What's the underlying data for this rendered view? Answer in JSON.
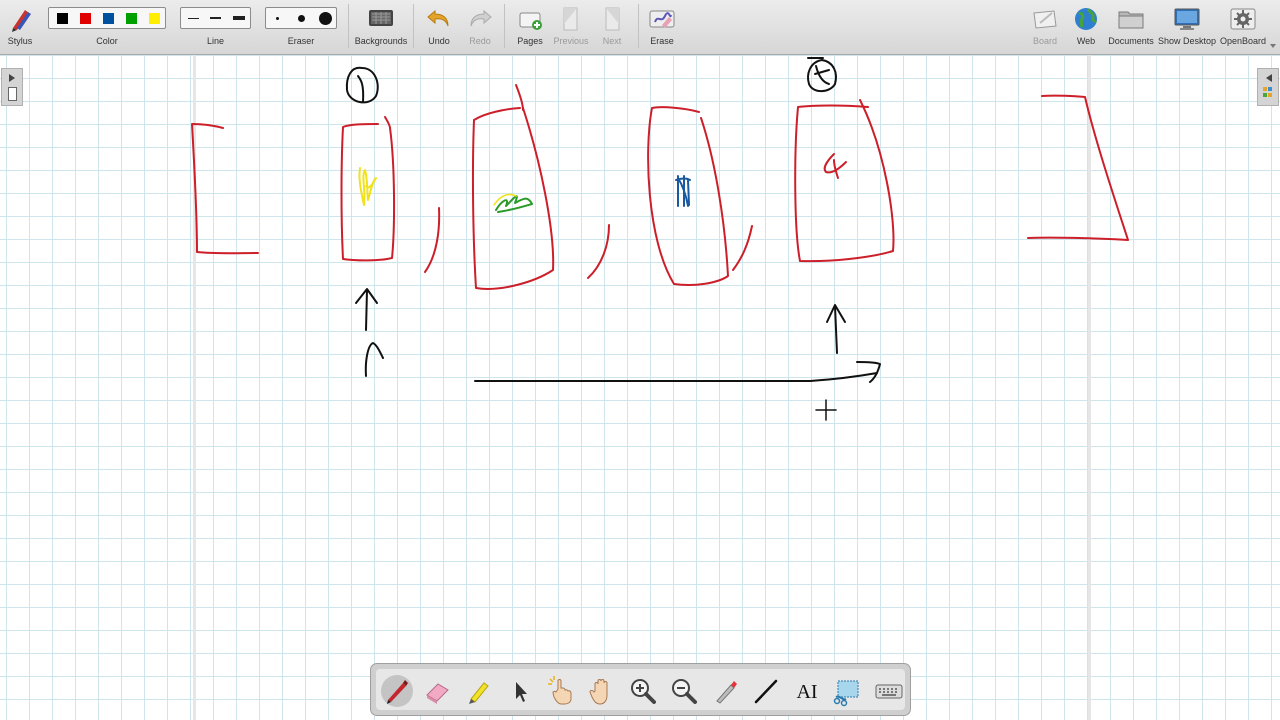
{
  "toolbar": {
    "stylus": "Stylus",
    "color": "Color",
    "line": "Line",
    "eraser": "Eraser",
    "backgrounds": "Backgrounds",
    "undo": "Undo",
    "redo": "Redo",
    "pages": "Pages",
    "previous": "Previous",
    "next": "Next",
    "erase": "Erase",
    "board": "Board",
    "web": "Web",
    "documents": "Documents",
    "show_desktop": "Show Desktop",
    "openboard": "OpenBoard"
  },
  "colors": {
    "palette": [
      "#000000",
      "#e00000",
      "#0050a0",
      "#00a000",
      "#ffee00"
    ],
    "ink_red": "#cc1f2a",
    "ink_black": "#111111",
    "ink_yellow": "#f2e21c",
    "ink_green": "#2a9a2a",
    "ink_blue": "#1a5aa0",
    "grid": "#cfe5ec"
  },
  "bottom_toolbar": {
    "tools": [
      "pen",
      "eraser",
      "highlighter",
      "selector",
      "interactor",
      "hand",
      "zoom-in",
      "zoom-out",
      "laser-pointer",
      "line",
      "text",
      "capture",
      "virtual-keyboard"
    ],
    "text_tool_label": "AI"
  }
}
